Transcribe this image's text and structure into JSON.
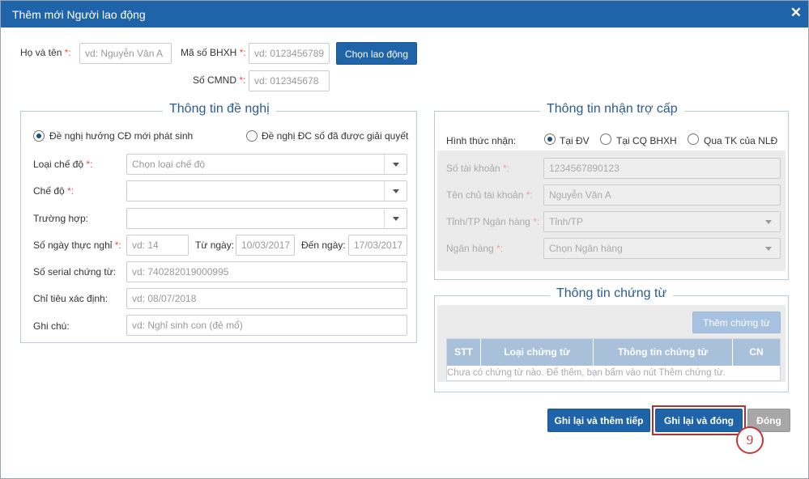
{
  "window": {
    "title": "Thêm mới Người lao động"
  },
  "top": {
    "name_label": "Họ và tên",
    "name_placeholder": "vd: Nguyễn Văn A",
    "bhxh_label": "Mã số BHXH",
    "bhxh_placeholder": "vd: 0123456789",
    "choose_button": "Chọn lao động",
    "cmnd_label": "Số CMND",
    "cmnd_placeholder": "vd: 012345678",
    "required_mark": "*:"
  },
  "proposal": {
    "legend": "Thông tin đề nghị",
    "radio1": "Đề nghị hưởng CĐ mới phát sinh",
    "radio2": "Đề nghị ĐC số đã được giải quyết",
    "regime_type_label": "Loại chế độ",
    "regime_type_placeholder": "Chọn loại chế độ",
    "regime_label": "Chế độ",
    "case_label": "Trường hợp:",
    "days_label": "Số ngày thực nghỉ",
    "days_placeholder": "vd: 14",
    "from_label": "Từ ngày:",
    "from_value": "10/03/2017",
    "to_label": "Đến ngày:",
    "to_value": "17/03/2017",
    "serial_label": "Số serial chứng từ:",
    "serial_placeholder": "vd: 740282019000995",
    "target_label": "Chỉ tiêu xác định:",
    "target_placeholder": "vd: 08/07/2018",
    "note_label": "Ghi chú:",
    "note_placeholder": "vd: Nghỉ sinh con (đẻ mổ)"
  },
  "benefit": {
    "legend": "Thông tin nhận trợ cấp",
    "method_label": "Hình thức nhận:",
    "opt1": "Tại ĐV",
    "opt2": "Tại CQ BHXH",
    "opt3": "Qua TK của NLĐ",
    "account_label": "Số tài khoản",
    "account_value": "1234567890123",
    "owner_label": "Tên chủ tài khoản",
    "owner_value": "Nguyễn Văn A",
    "province_label": "Tỉnh/TP Ngân hàng",
    "province_value": "Tỉnh/TP",
    "bank_label": "Ngân hàng",
    "bank_value": "Chọn Ngân hàng"
  },
  "documents": {
    "legend": "Thông tin chứng từ",
    "add_button": "Thêm chứng từ",
    "columns": [
      "STT",
      "Loại chứng từ",
      "Thông tin chứng từ",
      "CN"
    ],
    "empty_text": "Chưa có chứng từ nào. Để thêm, bạn bấm vào nút Thêm chứng từ."
  },
  "footer": {
    "save_add": "Ghi lại và thêm tiếp",
    "save_close": "Ghi lại và đóng",
    "close": "Đóng"
  },
  "annotation": {
    "step": "9"
  },
  "colors": {
    "primary": "#1f63a8",
    "highlight": "#b03033",
    "required": "#d9534f"
  }
}
